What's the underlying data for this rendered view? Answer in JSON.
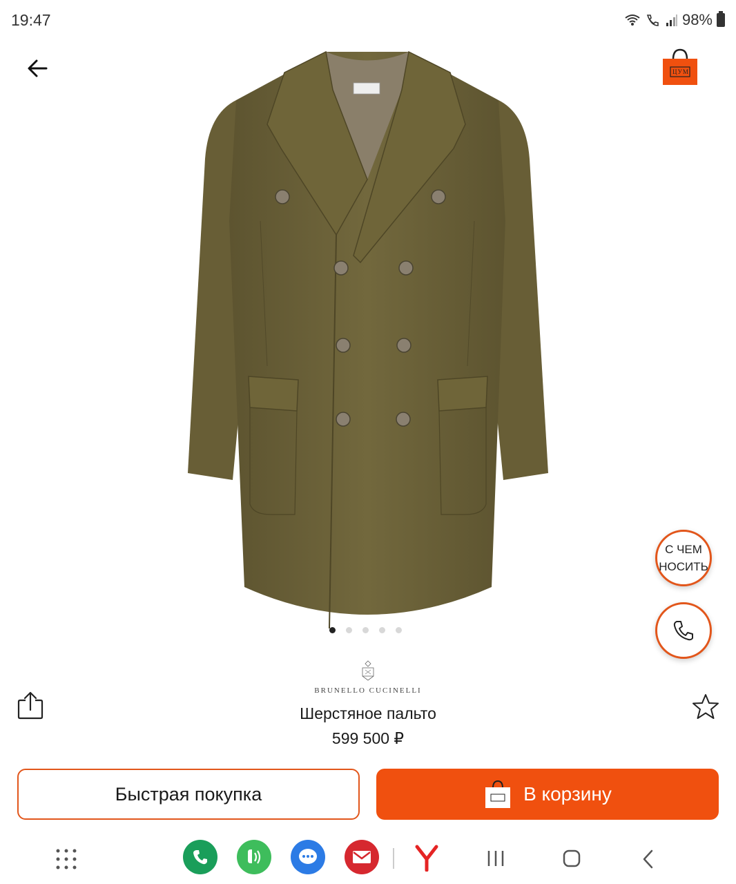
{
  "status_bar": {
    "time": "19:47",
    "battery": "98%"
  },
  "product": {
    "brand": "BRUNELLO CUCINELLI",
    "title": "Шерстяное пальто",
    "price": "599 500 ₽",
    "image_count": 5,
    "active_image_index": 0,
    "image_description_icon": "coat-photo"
  },
  "header": {
    "back_icon": "arrow-left-icon",
    "cart_icon": "shopping-bag-icon",
    "cart_logo": "ЦУМ"
  },
  "floating": {
    "outfit_label": "С ЧЕМ НОСИТЬ",
    "outfit_line1": "С ЧЕМ",
    "outfit_line2": "НОСИТЬ",
    "call_icon": "phone-icon"
  },
  "actions": {
    "quick_buy_label": "Быстрая покупка",
    "add_to_cart_label": "В корзину",
    "share_icon": "share-icon",
    "favorite_icon": "star-icon"
  },
  "nav_bar": {
    "apps": [
      "apps-grid-icon",
      "phone-app-icon",
      "whatsapp-style-icon",
      "messages-icon",
      "mail-icon",
      "yandex-icon"
    ],
    "system": [
      "recents-icon",
      "home-icon",
      "back-icon"
    ]
  },
  "colors": {
    "accent": "#f0500f",
    "accent_border": "#e2561b",
    "coat": "#6b6138"
  }
}
